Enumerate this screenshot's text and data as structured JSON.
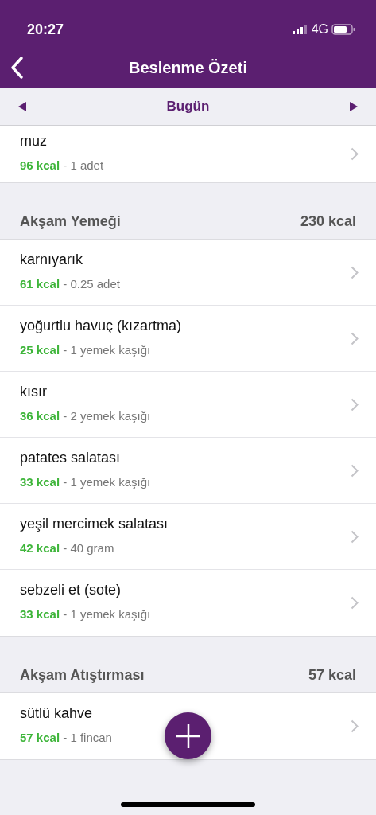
{
  "status_bar": {
    "time": "20:27",
    "network": "4G"
  },
  "nav": {
    "title": "Beslenme Özeti"
  },
  "date_bar": {
    "label": "Bugün"
  },
  "sections": [
    {
      "items": [
        {
          "name": "muz",
          "kcal": "96 kcal",
          "amount": " - 1 adet"
        }
      ]
    },
    {
      "title": "Akşam Yemeği",
      "total": "230 kcal",
      "items": [
        {
          "name": "karnıyarık",
          "kcal": "61 kcal",
          "amount": " - 0.25 adet"
        },
        {
          "name": "yoğurtlu havuç (kızartma)",
          "kcal": "25 kcal",
          "amount": " - 1 yemek kaşığı"
        },
        {
          "name": "kısır",
          "kcal": "36 kcal",
          "amount": " - 2 yemek kaşığı"
        },
        {
          "name": "patates salatası",
          "kcal": "33 kcal",
          "amount": " - 1 yemek kaşığı"
        },
        {
          "name": "yeşil mercimek salatası",
          "kcal": "42 kcal",
          "amount": " - 40 gram"
        },
        {
          "name": "sebzeli et (sote)",
          "kcal": "33 kcal",
          "amount": " - 1 yemek kaşığı"
        }
      ]
    },
    {
      "title": "Akşam Atıştırması",
      "total": "57 kcal",
      "items": [
        {
          "name": "sütlü kahve",
          "kcal": "57 kcal",
          "amount": " - 1 fincan"
        }
      ]
    }
  ]
}
